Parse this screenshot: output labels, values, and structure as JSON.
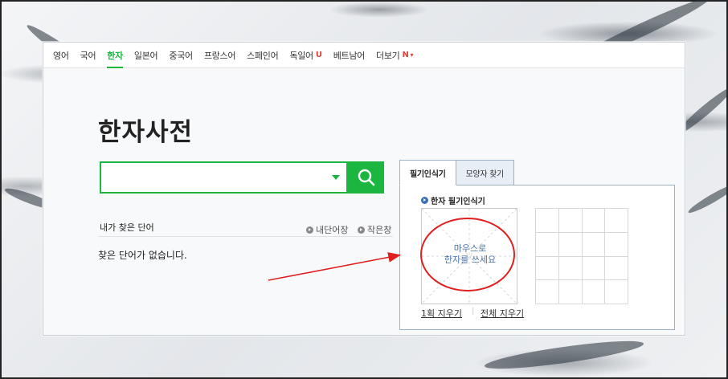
{
  "nav": {
    "items": [
      {
        "label": "영어"
      },
      {
        "label": "국어"
      },
      {
        "label": "한자",
        "active": true
      },
      {
        "label": "일본어"
      },
      {
        "label": "중국어"
      },
      {
        "label": "프랑스어"
      },
      {
        "label": "스페인어"
      },
      {
        "label": "독일어",
        "badge": "U"
      },
      {
        "label": "베트남어"
      },
      {
        "label": "더보기",
        "badge": "N"
      }
    ]
  },
  "page": {
    "title": "한자사전"
  },
  "search": {
    "value": "",
    "placeholder": ""
  },
  "history": {
    "title": "내가 찾은 단어",
    "my_wordbook": "내단어장",
    "small_window": "작은창",
    "empty_message": "찾은 단어가 없습니다."
  },
  "handwriting": {
    "tabs": [
      "필기인식기",
      "모양자 찾기"
    ],
    "panel_title": "한자 필기인식기",
    "hint_line1": "마우스로",
    "hint_line2": "한자를 쓰세요",
    "clear_one": "1획 지우기",
    "clear_all": "전체 지우기"
  },
  "colors": {
    "accent": "#1bb640",
    "badge": "#e2403a",
    "annotation": "#e01f1f",
    "tab_border": "#9bb0c9"
  },
  "icons": {
    "search": "magnifier-icon",
    "dropdown": "triangle-down-icon",
    "link_bullet": "circle-arrow-icon"
  }
}
